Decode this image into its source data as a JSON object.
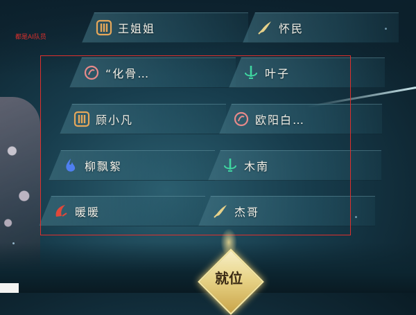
{
  "team_label": "都是AI队员",
  "slots": [
    {
      "name": "王姐姐",
      "icon": "gold-gear-icon"
    },
    {
      "name": "怀民",
      "icon": "gold-wing-icon"
    },
    {
      "name": "“化骨…",
      "icon": "pink-ring-icon"
    },
    {
      "name": "叶子",
      "icon": "green-sword-icon"
    },
    {
      "name": "顾小凡",
      "icon": "gold-gear-icon"
    },
    {
      "name": "欧阳白…",
      "icon": "pink-ring-icon"
    },
    {
      "name": "柳飘絮",
      "icon": "blue-flame-icon"
    },
    {
      "name": "木南",
      "icon": "green-sword-icon"
    },
    {
      "name": "暖暖",
      "icon": "red-blade-icon"
    },
    {
      "name": "杰哥",
      "icon": "gold-wing-icon"
    }
  ],
  "ready_button": "就位",
  "colors": {
    "gold": "#e7a85a",
    "wing_gold": "#e6d18a",
    "pink": "#e88a8a",
    "green": "#3fd6a0",
    "blue": "#4f7ff0",
    "red": "#e0483a",
    "highlight": "#e0302d"
  }
}
